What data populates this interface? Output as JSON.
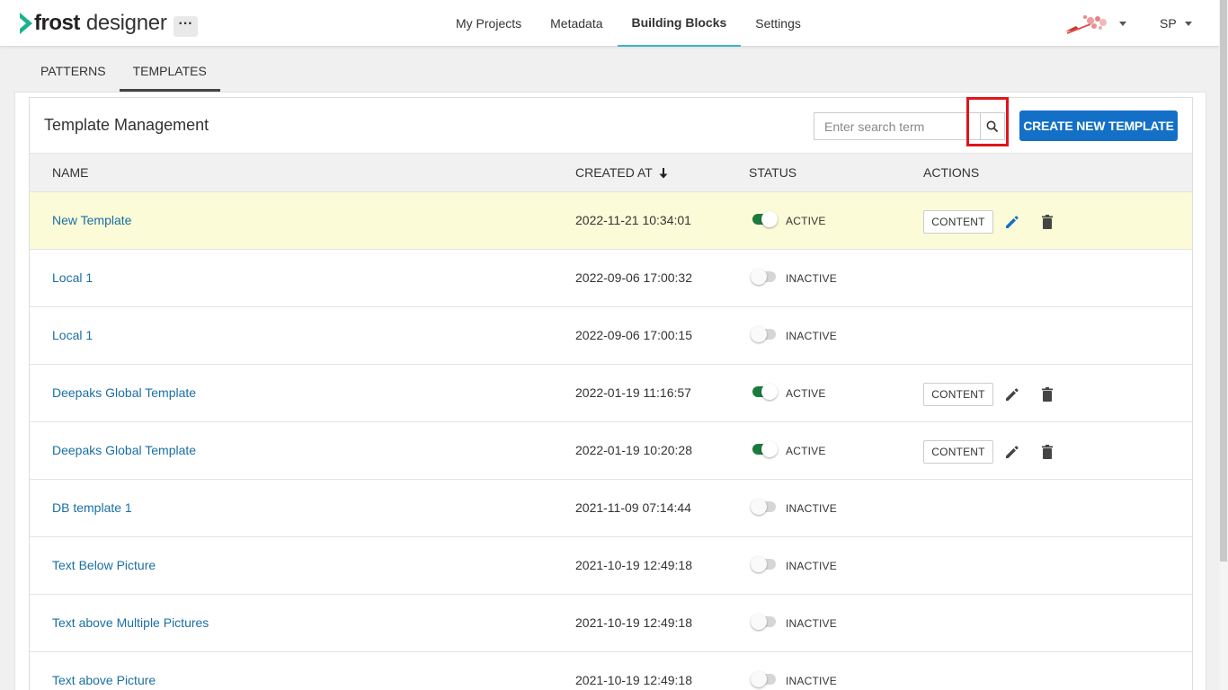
{
  "header": {
    "logo_bold": "frost",
    "logo_light": "designer",
    "more_label": "···",
    "nav": [
      {
        "label": "My Projects",
        "active": false
      },
      {
        "label": "Metadata",
        "active": false
      },
      {
        "label": "Building Blocks",
        "active": true
      },
      {
        "label": "Settings",
        "active": false
      }
    ],
    "user_initials": "SP"
  },
  "subtabs": [
    {
      "label": "PATTERNS",
      "active": false
    },
    {
      "label": "TEMPLATES",
      "active": true
    }
  ],
  "panel": {
    "title": "Template Management",
    "search_placeholder": "Enter search term",
    "create_button": "CREATE NEW TEMPLATE"
  },
  "table": {
    "columns": {
      "name": "NAME",
      "created_at": "CREATED AT",
      "status": "STATUS",
      "actions": "ACTIONS"
    },
    "content_label": "CONTENT",
    "rows": [
      {
        "name": "New Template",
        "created_at": "2022-11-21 10:34:01",
        "status": "ACTIVE",
        "active": true,
        "highlight": true
      },
      {
        "name": "Local 1",
        "created_at": "2022-09-06 17:00:32",
        "status": "INACTIVE",
        "active": false
      },
      {
        "name": "Local 1",
        "created_at": "2022-09-06 17:00:15",
        "status": "INACTIVE",
        "active": false
      },
      {
        "name": "Deepaks Global Template",
        "created_at": "2022-01-19 11:16:57",
        "status": "ACTIVE",
        "active": true
      },
      {
        "name": "Deepaks Global Template",
        "created_at": "2022-01-19 10:20:28",
        "status": "ACTIVE",
        "active": true
      },
      {
        "name": "DB template 1",
        "created_at": "2021-11-09 07:14:44",
        "status": "INACTIVE",
        "active": false
      },
      {
        "name": "Text Below Picture",
        "created_at": "2021-10-19 12:49:18",
        "status": "INACTIVE",
        "active": false
      },
      {
        "name": "Text above Multiple Pictures",
        "created_at": "2021-10-19 12:49:18",
        "status": "INACTIVE",
        "active": false
      },
      {
        "name": "Text above Picture",
        "created_at": "2021-10-19 12:49:18",
        "status": "INACTIVE",
        "active": false
      }
    ]
  },
  "colors": {
    "accent": "#1470c7",
    "nav_underline": "#3cb3c9",
    "toggle_on": "#1d7a3e",
    "link": "#1a6fa3",
    "highlight_row": "#fbfbd7",
    "annotation_box": "#e0141c"
  }
}
